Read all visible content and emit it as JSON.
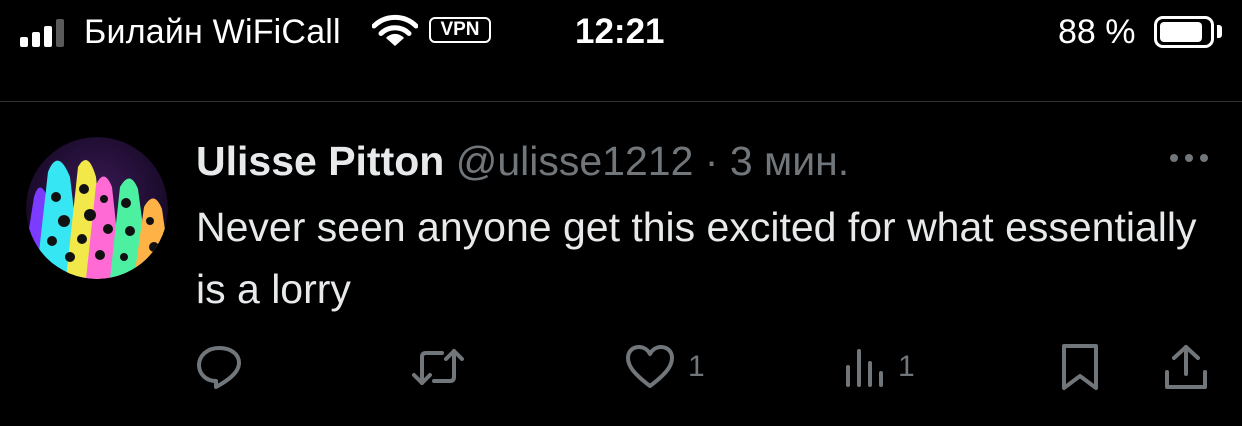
{
  "status_bar": {
    "carrier": "Билайн WiFiCall",
    "vpn_label": "VPN",
    "time": "12:21",
    "battery_text": "88 %",
    "battery_level": 0.88,
    "signal_bars": 3
  },
  "tweet": {
    "display_name": "Ulisse Pitton",
    "handle": "@ulisse1212",
    "separator": "·",
    "timestamp": "3 мин.",
    "text": "Never seen anyone get this excited for what essentially is a lorry",
    "avatar_icon": "avatar-image",
    "actions": {
      "reply": {
        "icon": "reply-icon",
        "count": ""
      },
      "retweet": {
        "icon": "retweet-icon",
        "count": ""
      },
      "like": {
        "icon": "heart-icon",
        "count": "1"
      },
      "views": {
        "icon": "views-icon",
        "count": "1"
      },
      "bookmark": {
        "icon": "bookmark-icon"
      },
      "share": {
        "icon": "share-icon"
      }
    }
  },
  "colors": {
    "background": "#000000",
    "primary_text": "#e7e9ea",
    "secondary_text": "#71767b",
    "divider": "#2f3336"
  }
}
